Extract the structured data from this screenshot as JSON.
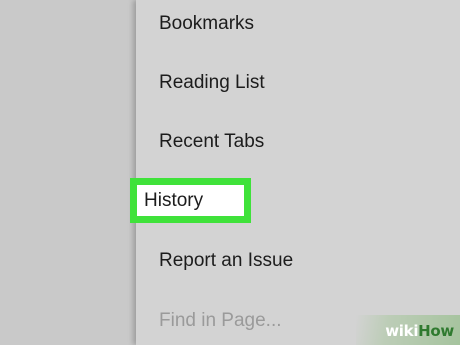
{
  "menu": {
    "items": [
      {
        "label": "Bookmarks"
      },
      {
        "label": "Reading List"
      },
      {
        "label": "Recent Tabs"
      },
      {
        "label": "History"
      },
      {
        "label": "Report an Issue"
      },
      {
        "label": "Find in Page..."
      }
    ],
    "highlighted_item": "History",
    "highlight_color": "#3fe23a",
    "disabled_item": "Find in Page..."
  },
  "watermark": {
    "part1": "wiki",
    "part2": "How"
  }
}
